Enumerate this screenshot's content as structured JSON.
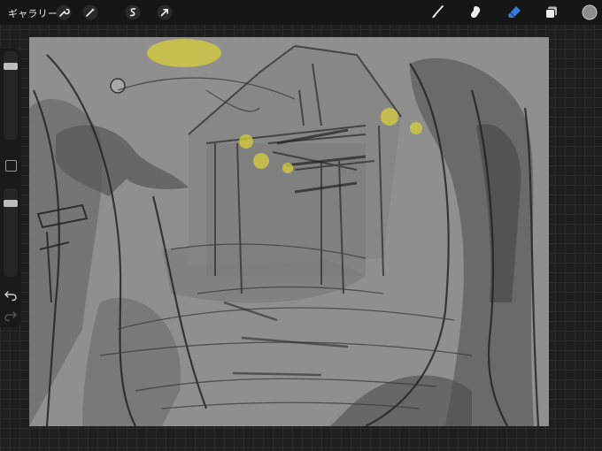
{
  "topbar": {
    "gallery_label": "ギャラリー",
    "left_tools": [
      "wrench-icon",
      "magic-wand-icon",
      "selection-icon",
      "transform-arrow-icon"
    ],
    "right_tools": [
      "brush-icon",
      "smudge-icon",
      "eraser-icon",
      "layers-icon",
      "color-swatch"
    ],
    "active_tool": "eraser",
    "current_color": "#8c8c8c",
    "accent_color": "#3a7bd5"
  },
  "sidebar": {
    "brush_size_level": 0.14,
    "opacity_level": 0.14,
    "modify_button": "square-icon",
    "undo": "undo-icon",
    "redo": "redo-icon"
  },
  "canvas": {
    "background_color": "#8f8f8f",
    "highlight_color": "#d8cf3a"
  }
}
